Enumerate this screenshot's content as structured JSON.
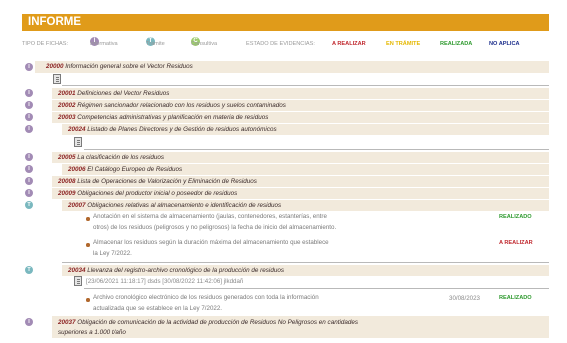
{
  "header": {
    "title": "INFORME"
  },
  "legend": {
    "label": "TIPO DE FICHAS:",
    "types": [
      {
        "icon": "info-icon",
        "letter": "I",
        "label": "Informativa",
        "color": "#a28bb5"
      },
      {
        "icon": "process-icon",
        "letter": "T",
        "label": "Trámite",
        "color": "#7ab8bf"
      },
      {
        "icon": "consult-icon",
        "letter": "C",
        "label": "Consultiva",
        "color": "#9ccb6d"
      }
    ],
    "evidence_label": "ESTADO DE EVIDENCIAS:",
    "states": [
      {
        "label": "A REALIZAR",
        "color": "#c0282e"
      },
      {
        "label": "EN TRÁMITE",
        "color": "#e5b800"
      },
      {
        "label": "REALIZADA",
        "color": "#2f9a2f"
      },
      {
        "label": "NO APLICA",
        "color": "#1c2e8c"
      }
    ]
  },
  "rows": [
    {
      "code": "20000",
      "title": "Información general sobre el Vector Residuos"
    },
    {
      "code": "20001",
      "title": "Definiciones del Vector Residuos"
    },
    {
      "code": "20002",
      "title": "Régimen sancionador relacionado con los residuos y suelos contaminados"
    },
    {
      "code": "20003",
      "title": "Competencias administrativas y planificación en materia de residuos"
    },
    {
      "code": "20024",
      "title": "Listado de Planes Directores y de Gestión de residuos autonómicos"
    },
    {
      "code": "20005",
      "title": "La clasificación de los residuos"
    },
    {
      "code": "20006",
      "title": "El Catálogo Europeo de Residuos"
    },
    {
      "code": "20008",
      "title": "Lista de Operaciones de Valorización y Eliminación de Residuos"
    },
    {
      "code": "20009",
      "title": "Obligaciones del productor inicial o poseedor de residuos"
    },
    {
      "code": "20007",
      "title": "Obligaciones relativas al almacenamiento e identificación de residuos"
    },
    {
      "code": "20034",
      "title": "Llevanza del registro-archivo cronológico de la producción de residuos"
    },
    {
      "code": "20037",
      "title": "Obligación de comunicación de la actividad de producción de Residuos No Peligrosos en cantidades",
      "title2": "superiores a 1.000 t/año"
    }
  ],
  "evidences_20007": [
    {
      "line1": "Anotación en el sistema de almacenamiento (jaulas, contenedores, estanterías, entre",
      "line2": "otros) de los residuos (peligrosos y no peligrosos) la fecha de inicio del almacenamiento.",
      "status": "REALIZADO"
    },
    {
      "line1": "Almacenar los residuos según la duración máxima del almacenamiento que establece",
      "line2": "la Ley 7/2022.",
      "status": "A REALIZAR"
    }
  ],
  "record_20034": {
    "meta": "[23/06/2021 11:18:17]  dsds  [30/08/2022 11:42:06] jlkddañ",
    "evidence": {
      "line1": "Archivo cronológico electrónico de los residuos generados con toda la información",
      "line2": "actualizada que se establece en la Ley 7/2022.",
      "date": "30/08/2023",
      "status": "REALIZADO"
    }
  }
}
